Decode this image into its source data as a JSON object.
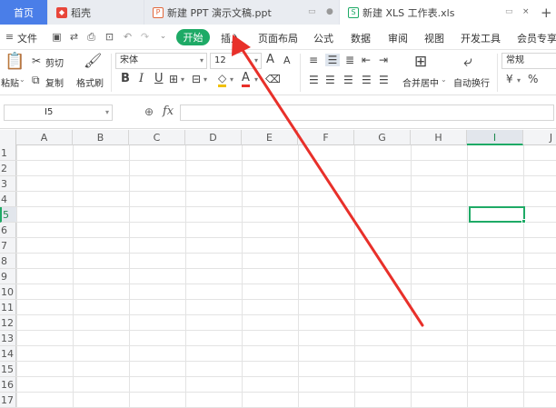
{
  "tabs": {
    "home": "首页",
    "docer": "稻壳",
    "ppt": "新建 PPT 演示文稿.ppt",
    "xls": "新建 XLS 工作表.xls",
    "add": "+"
  },
  "menu": {
    "file": "文件",
    "start": "开始",
    "insert": "插入",
    "page_layout": "页面布局",
    "formula": "公式",
    "data": "数据",
    "review": "审阅",
    "view": "视图",
    "dev_tools": "开发工具",
    "member": "会员专享"
  },
  "ribbon": {
    "paste": "粘贴",
    "cut": "剪切",
    "copy": "复制",
    "format_painter": "格式刷",
    "font_name": "宋体",
    "font_size": "12",
    "bold": "B",
    "italic": "I",
    "underline": "U",
    "font_color_glyph": "A",
    "grow_font": "A",
    "shrink_font": "A",
    "merge_center": "合并居中",
    "wrap_text": "自动换行",
    "number_format": "常规",
    "currency": "¥",
    "percent": "%"
  },
  "formula_bar": {
    "cell_ref": "I5",
    "fx": "fx",
    "formula": ""
  },
  "grid": {
    "columns": [
      "A",
      "B",
      "C",
      "D",
      "E",
      "F",
      "G",
      "H",
      "I",
      "J"
    ],
    "rows": [
      "1",
      "2",
      "3",
      "4",
      "5",
      "6",
      "7",
      "8",
      "9",
      "10",
      "11",
      "12",
      "13",
      "14",
      "15",
      "16",
      "17"
    ],
    "active_column": "I",
    "active_row": "5"
  },
  "colors": {
    "accent_green": "#1eaa66",
    "home_tab_blue": "#4a7ee8",
    "annotation_red": "#e8302a"
  }
}
